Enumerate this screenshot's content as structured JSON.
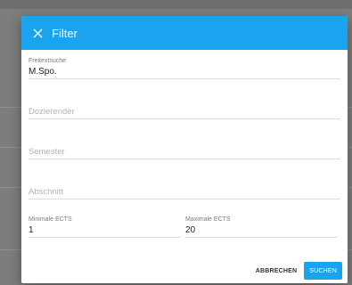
{
  "dialog": {
    "title": "Filter",
    "close_icon": "close-icon",
    "accent_color": "#1aa3ef"
  },
  "fields": {
    "freitext": {
      "label": "Freitextsuche",
      "value": "M.Spo."
    },
    "dozierender": {
      "placeholder": "Dozierender"
    },
    "semester": {
      "placeholder": "Semester"
    },
    "abschnitt": {
      "placeholder": "Abschnitt"
    },
    "min_ects": {
      "label": "Minimale ECTS",
      "value": "1"
    },
    "max_ects": {
      "label": "Maximale ECTS",
      "value": "20"
    }
  },
  "actions": {
    "cancel_label": "ABBRECHEN",
    "search_label": "SUCHEN"
  }
}
